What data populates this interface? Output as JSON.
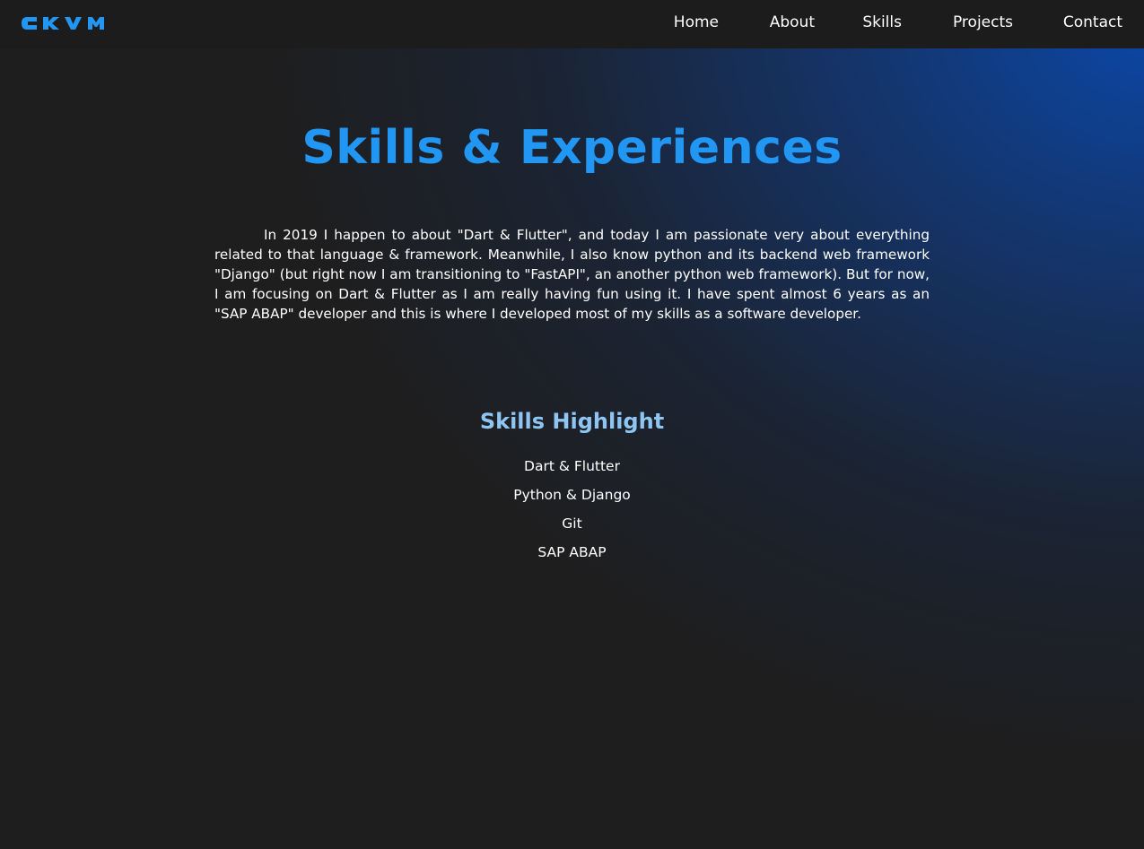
{
  "navbar": {
    "logo_text": "CKVM",
    "links": [
      {
        "label": "Home"
      },
      {
        "label": "About"
      },
      {
        "label": "Skills"
      },
      {
        "label": "Projects"
      },
      {
        "label": "Contact"
      }
    ]
  },
  "main": {
    "title": "Skills & Experiences",
    "intro": "In 2019 I happen to about \"Dart & Flutter\", and today I am passionate very about everything related to that language & framework. Meanwhile, I also know python and its backend web framework \"Django\" (but right now I am transitioning to \"FastAPI\", an another python web framework). But for now, I am focusing on Dart & Flutter as I am really having fun using it. I have spent almost 6 years as an \"SAP ABAP\" developer and this is where I developed most of my skills as a software developer.",
    "skills_title": "Skills Highlight",
    "skills": [
      {
        "label": "Dart & Flutter"
      },
      {
        "label": "Python & Django"
      },
      {
        "label": "Git"
      },
      {
        "label": "SAP ABAP"
      }
    ]
  },
  "colors": {
    "accent": "#2196f3",
    "subheading": "#8ec5f2",
    "navbar_bg": "#1c1c1c",
    "page_bg": "#1e1e1e"
  }
}
